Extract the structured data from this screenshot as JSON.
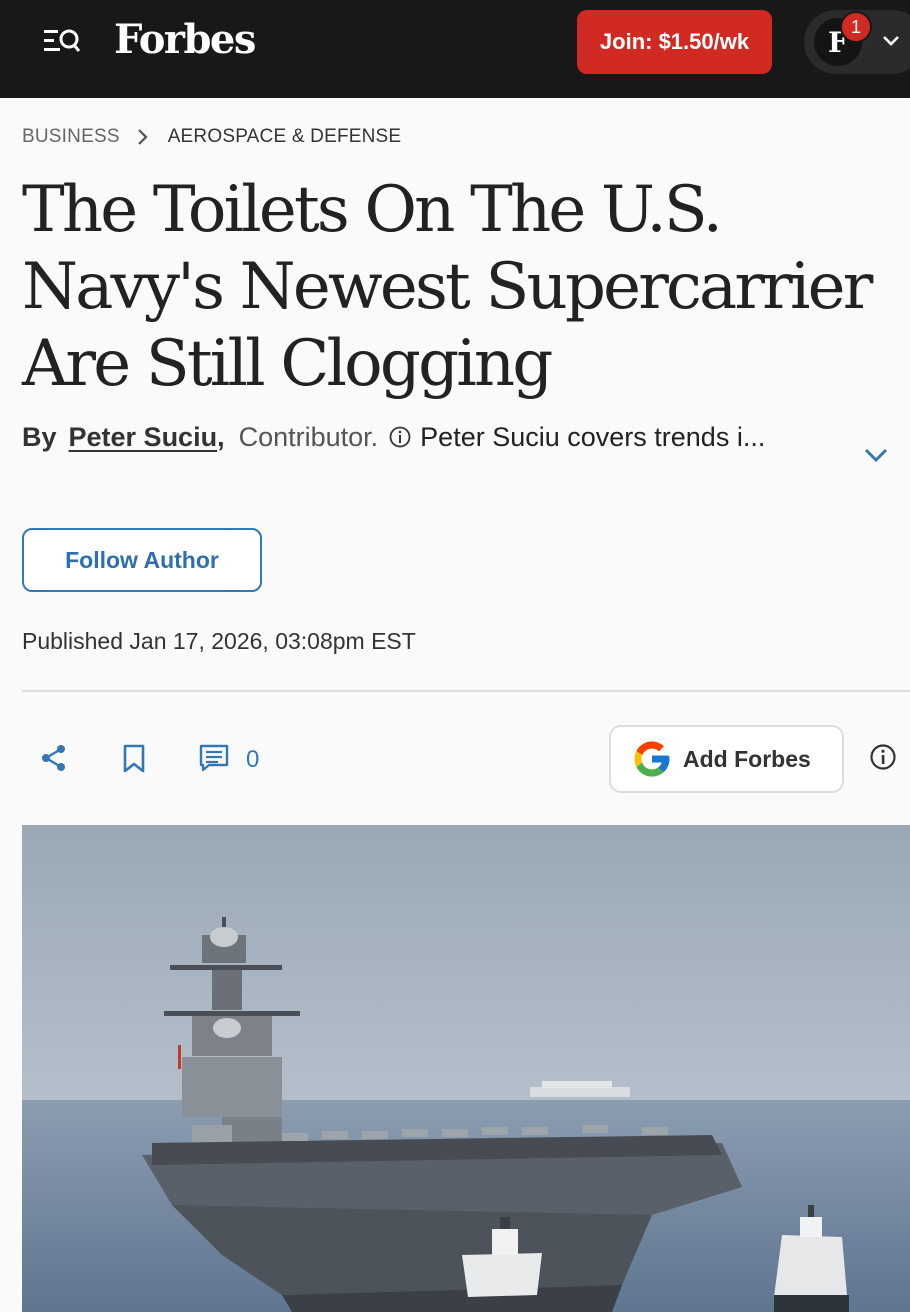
{
  "header": {
    "brand": "Forbes",
    "join_label": "Join: $1.50/wk",
    "avatar_initial": "F",
    "notification_count": "1"
  },
  "breadcrumb": {
    "section": "BUSINESS",
    "subsection": "AEROSPACE & DEFENSE"
  },
  "article": {
    "headline": "The Toilets On The U.S. Navy's Newest Supercarrier Are Still Clogging",
    "by_label": "By",
    "author": "Peter Suciu",
    "comma": ",",
    "author_role": "Contributor.",
    "author_bio": "Peter Suciu covers trends i...",
    "follow_label": "Follow Author",
    "published": "Published Jan 17, 2026, 03:08pm EST"
  },
  "actions": {
    "comment_count": "0",
    "add_forbes_label": "Add Forbes"
  },
  "colors": {
    "header_bg": "#181818",
    "join_red": "#d12a22",
    "link_blue": "#3377b5"
  }
}
